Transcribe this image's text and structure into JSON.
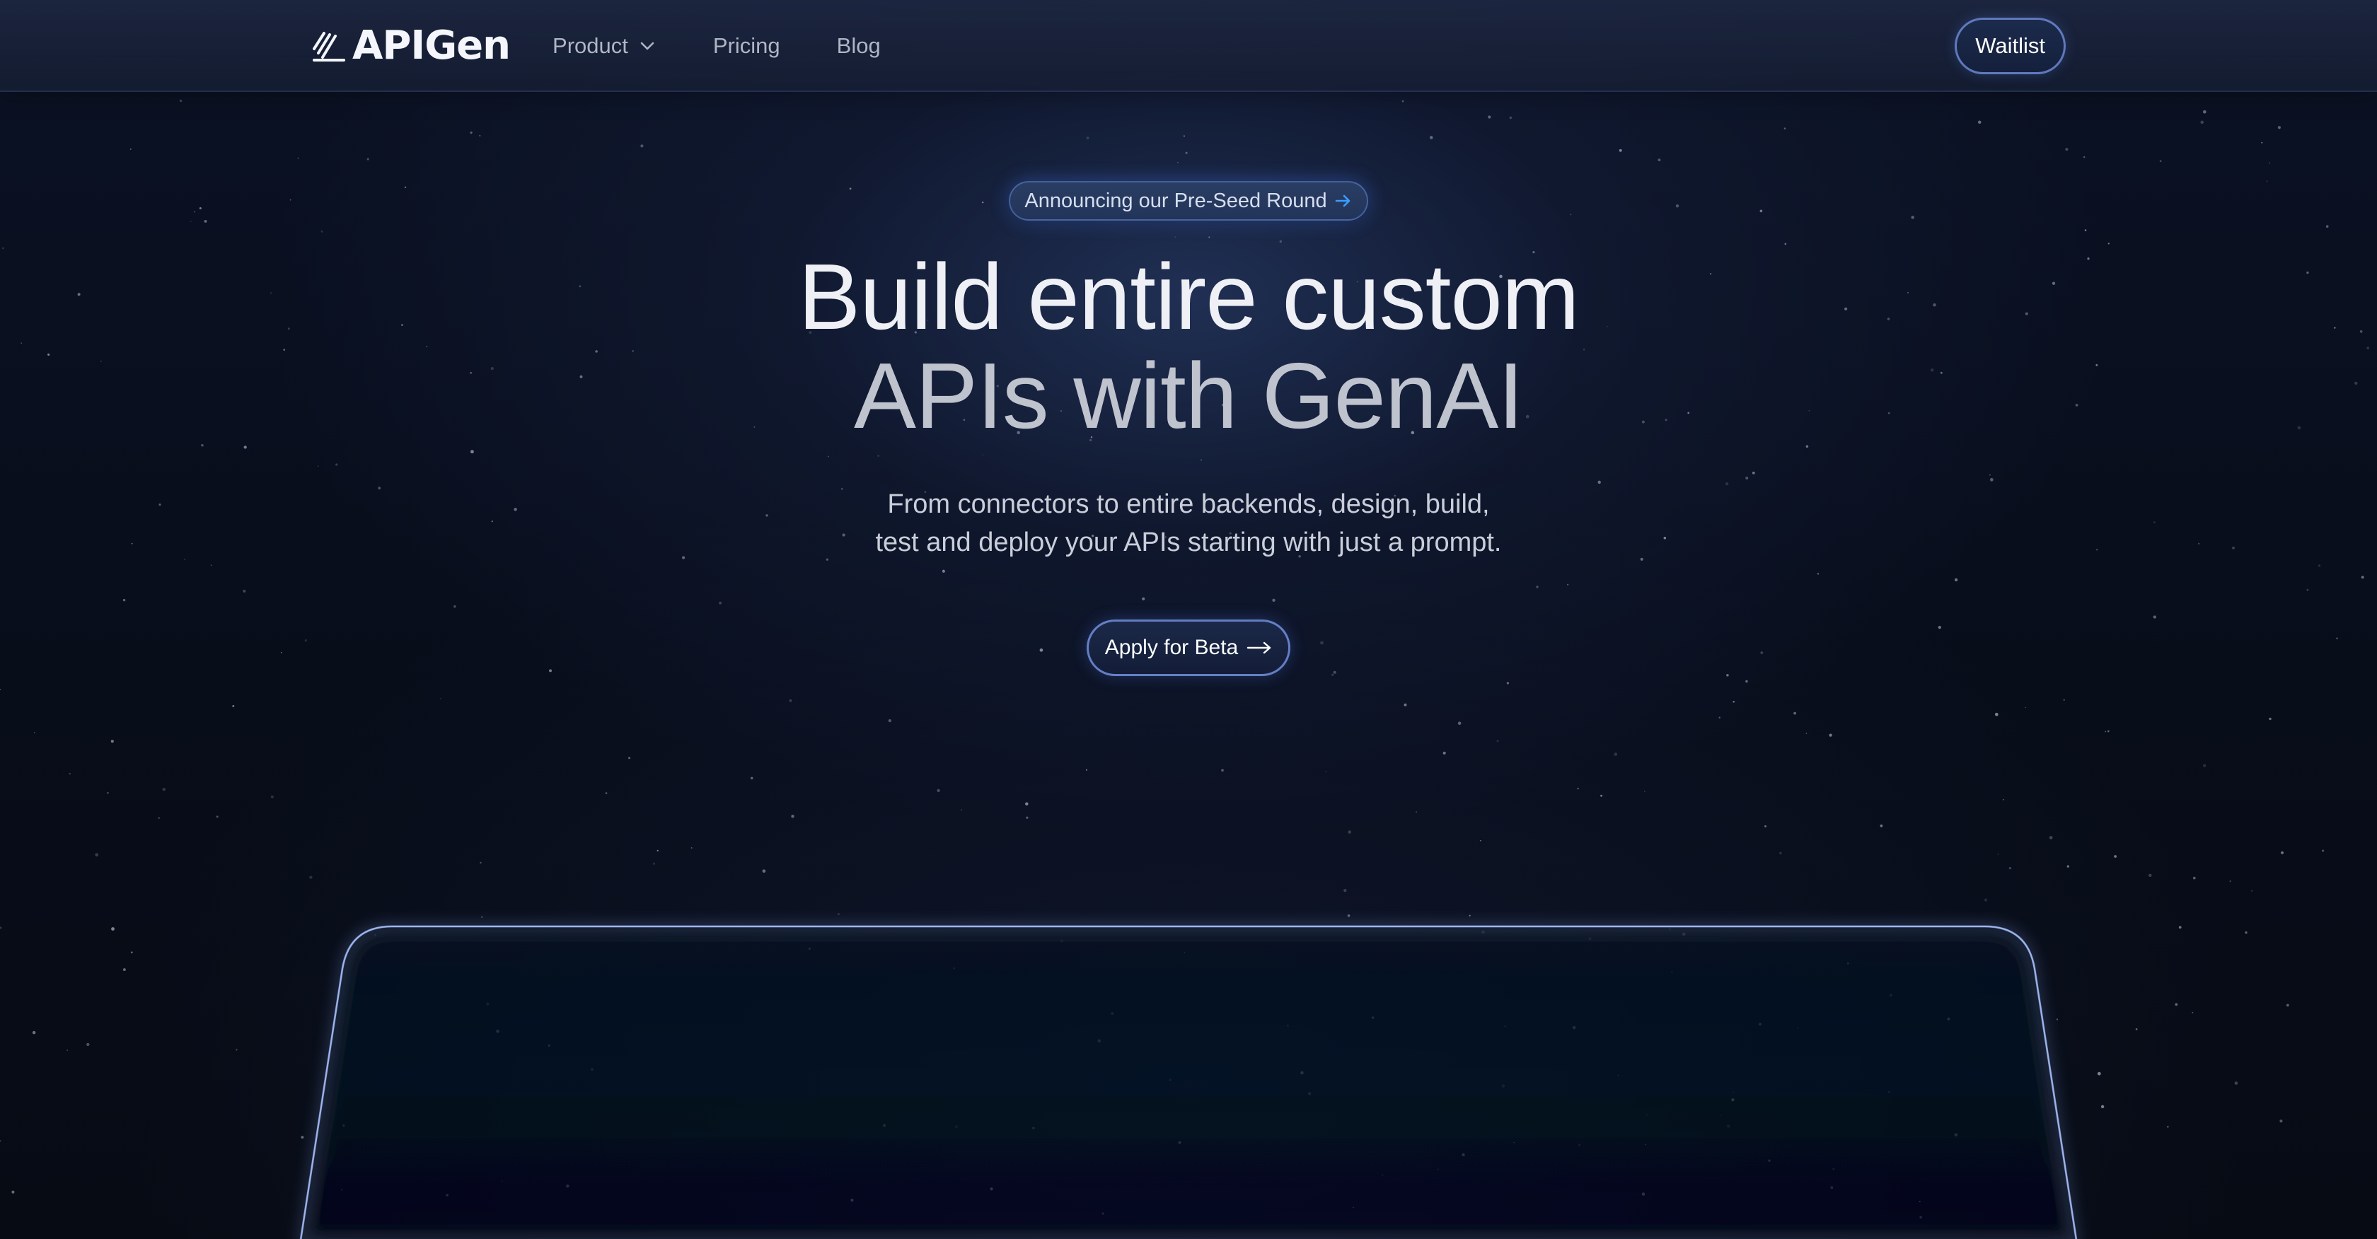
{
  "brand": {
    "name": "APIGen",
    "logo_icon": "stacked-slashes-logo-icon"
  },
  "nav": {
    "items": [
      {
        "label": "Product",
        "has_dropdown": true,
        "icon": "chevron-down-icon"
      },
      {
        "label": "Pricing"
      },
      {
        "label": "Blog"
      }
    ],
    "cta_label": "Waitlist"
  },
  "announcement": {
    "label": "Announcing our Pre-Seed Round",
    "icon": "arrow-right-icon",
    "accent": "#3b9cff"
  },
  "hero": {
    "title_line1": "Build entire custom",
    "title_line2": "APIs with GenAI",
    "subtitle_line1": "From connectors to entire backends, design, build,",
    "subtitle_line2": "test and deploy your APIs starting with just a prompt.",
    "cta_label": "Apply for Beta",
    "cta_icon": "long-arrow-right-icon"
  },
  "colors": {
    "background": "#070b14",
    "nav_background": "#1e2842",
    "button_border": "#7896e6",
    "frame_glow": "#8fb0ff"
  }
}
